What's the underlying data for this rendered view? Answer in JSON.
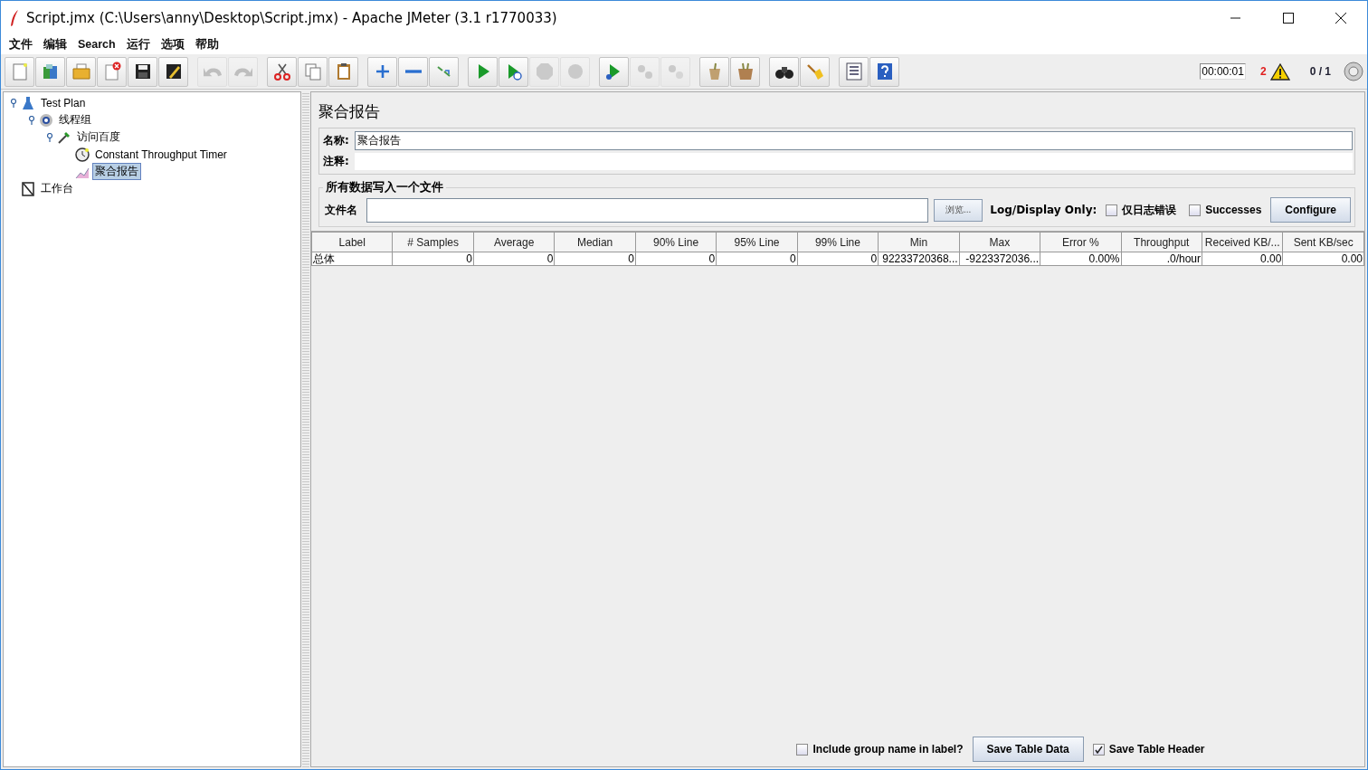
{
  "window": {
    "title": "Script.jmx (C:\\Users\\anny\\Desktop\\Script.jmx) - Apache JMeter (3.1 r1770033)",
    "controls": [
      {
        "kind": "minimize"
      },
      {
        "kind": "maximize"
      },
      {
        "kind": "close"
      }
    ]
  },
  "menu": [
    "文件",
    "编辑",
    "Search",
    "运行",
    "选项",
    "帮助"
  ],
  "toolbar": [
    [
      {
        "kind": "new",
        "disabled": false
      },
      {
        "kind": "templates",
        "disabled": false
      },
      {
        "kind": "open",
        "disabled": false
      },
      {
        "kind": "close",
        "disabled": false
      },
      {
        "kind": "save",
        "disabled": false
      },
      {
        "kind": "saveas",
        "disabled": false
      }
    ],
    [
      {
        "kind": "undo",
        "disabled": true
      },
      {
        "kind": "redo",
        "disabled": true
      }
    ],
    [
      {
        "kind": "cut",
        "disabled": false
      },
      {
        "kind": "copy",
        "disabled": false
      },
      {
        "kind": "paste",
        "disabled": false
      }
    ],
    [
      {
        "kind": "expand",
        "disabled": false
      },
      {
        "kind": "collapse",
        "disabled": false
      },
      {
        "kind": "toggle",
        "disabled": false
      }
    ],
    [
      {
        "kind": "start",
        "disabled": false
      },
      {
        "kind": "startnopause",
        "disabled": false
      },
      {
        "kind": "stop",
        "disabled": true
      },
      {
        "kind": "shutdown",
        "disabled": true
      }
    ],
    [
      {
        "kind": "remotestart",
        "disabled": false
      },
      {
        "kind": "remotestop",
        "disabled": true
      },
      {
        "kind": "remoteexit",
        "disabled": true
      }
    ],
    [
      {
        "kind": "clear",
        "disabled": false
      },
      {
        "kind": "clearall",
        "disabled": false
      }
    ],
    [
      {
        "kind": "search",
        "disabled": false
      },
      {
        "kind": "reset",
        "disabled": false
      }
    ],
    [
      {
        "kind": "function",
        "disabled": false
      },
      {
        "kind": "help",
        "disabled": false
      }
    ]
  ],
  "status": {
    "elapsed": "00:00:01",
    "errors": "2",
    "threads": "0 / 1"
  },
  "tree": [
    {
      "label": "Test Plan",
      "kind": "plan",
      "selected": false,
      "children": [
        {
          "label": "线程组",
          "kind": "threadgroup",
          "selected": false,
          "children": [
            {
              "label": "访问百度",
              "kind": "sampler",
              "selected": false,
              "children": [
                {
                  "label": "Constant Throughput Timer",
                  "kind": "timer",
                  "selected": false
                },
                {
                  "label": "聚合报告",
                  "kind": "listener",
                  "selected": true
                }
              ]
            }
          ]
        }
      ]
    },
    {
      "label": "工作台",
      "kind": "workbench",
      "selected": false
    }
  ],
  "panel": {
    "title": "聚合报告",
    "name_label": "名称:",
    "name_value": "聚合报告",
    "comment_label": "注释:",
    "file_group": "所有数据写入一个文件",
    "file_label": "文件名",
    "browse": "浏览...",
    "log_label": "Log/Display Only:",
    "errors_only": {
      "label": "仅日志错误",
      "checked": false
    },
    "successes": {
      "label": "Successes",
      "checked": false
    },
    "configure": "Configure"
  },
  "table": {
    "columns": [
      "Label",
      "# Samples",
      "Average",
      "Median",
      "90% Line",
      "95% Line",
      "99% Line",
      "Min",
      "Max",
      "Error %",
      "Throughput",
      "Received KB/...",
      "Sent KB/sec"
    ],
    "rows": [
      [
        "总体",
        "0",
        "0",
        "0",
        "0",
        "0",
        "0",
        "92233720368...",
        "-9223372036...",
        "0.00%",
        ".0/hour",
        "0.00",
        "0.00"
      ]
    ]
  },
  "footer": {
    "include_group": {
      "label": "Include group name in label?",
      "checked": false
    },
    "save_data": "Save Table Data",
    "save_header": {
      "label": "Save Table Header",
      "checked": true
    }
  }
}
